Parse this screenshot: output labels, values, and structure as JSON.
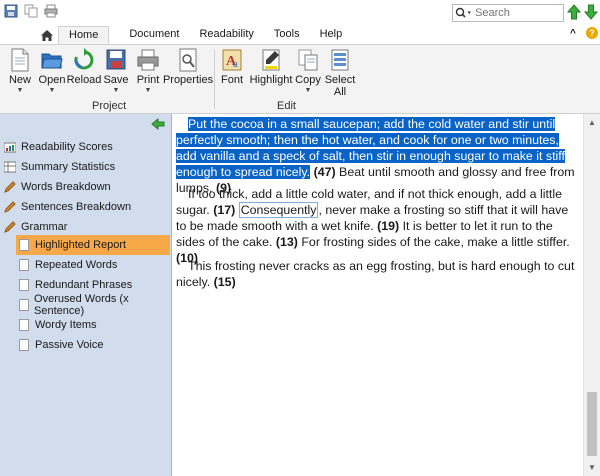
{
  "quick_access": {
    "icons": [
      "save-icon",
      "copy-icon",
      "print-icon"
    ]
  },
  "tabs": [
    {
      "label": "Home"
    },
    {
      "label": "Document"
    },
    {
      "label": "Readability"
    },
    {
      "label": "Tools"
    },
    {
      "label": "Help"
    }
  ],
  "search": {
    "placeholder": "Search",
    "value": ""
  },
  "ribbon": {
    "project_group": "Project",
    "edit_group": "Edit",
    "buttons": {
      "new": "New",
      "open": "Open",
      "reload": "Reload",
      "save": "Save",
      "print": "Print",
      "properties": "Properties",
      "font": "Font",
      "highlight": "Highlight",
      "copy": "Copy",
      "select_all_1": "Select",
      "select_all_2": "All"
    }
  },
  "sidebar": {
    "items": [
      {
        "label": "Readability Scores"
      },
      {
        "label": "Summary Statistics"
      },
      {
        "label": "Words Breakdown"
      },
      {
        "label": "Sentences Breakdown"
      },
      {
        "label": "Grammar"
      },
      {
        "label": "Highlighted Report"
      },
      {
        "label": "Repeated Words"
      },
      {
        "label": "Redundant Phrases"
      },
      {
        "label": "Overused Words (x Sentence)"
      },
      {
        "label": "Wordy Items"
      },
      {
        "label": "Passive Voice"
      }
    ]
  },
  "content": {
    "p1_highlight": "Put the cocoa in a small saucepan; add the cold water and stir until perfectly smooth; then the hot water, and cook for one or two minutes, add vanilla and a speck of salt, then stir in enough sugar to make it stiff enough to spread nicely.",
    "p1_n1": "(47)",
    "p1_text2": " Beat until smooth and glossy and free from lumps. ",
    "p1_n2": "(9)",
    "p2_text1": "If too thick, add a little cold water, and if not thick enough, add a little sugar. ",
    "p2_n1": "(17)",
    "p2_boxed": "Consequently",
    "p2_text2": ", never make a frosting so stiff that it will have to be made smooth with a wet knife. ",
    "p2_n2": "(19)",
    "p2_text3": " It is better to let it run to the sides of the cake. ",
    "p2_n3": "(13)",
    "p2_text4": " For frosting sides of the cake, make a little stiffer. ",
    "p2_n4": "(10)",
    "p3_text1": "This frosting never cracks as an egg frosting, but is hard enough to cut nicely. ",
    "p3_n1": "(15)"
  },
  "colors": {
    "selection": "#0a64c8",
    "sidebar_bg": "#d1dcec",
    "sidebar_selected": "#f7a94a",
    "ribbon_bg": "#f3f3f3"
  }
}
